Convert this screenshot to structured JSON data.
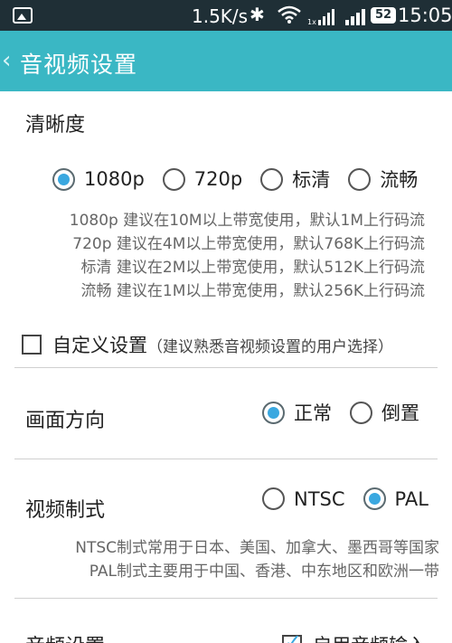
{
  "status_bar": {
    "speed": "1.5K/s",
    "battery": "52",
    "time": "15:05",
    "icons": [
      "image-icon",
      "bluetooth-icon",
      "wifi-icon",
      "signal-icon",
      "battery-icon"
    ]
  },
  "header": {
    "back_glyph": "《",
    "title": "音视频设置",
    "background": "#3ab7c4"
  },
  "resolution": {
    "title": "清晰度",
    "options": [
      {
        "label": "1080p",
        "selected": true
      },
      {
        "label": "720p",
        "selected": false
      },
      {
        "label": "标清",
        "selected": false
      },
      {
        "label": "流畅",
        "selected": false
      }
    ],
    "descriptions": [
      "1080p 建议在10M以上带宽使用，默认1M上行码流",
      "720p 建议在4M以上带宽使用，默认768K上行码流",
      "标清 建议在2M以上带宽使用，默认512K上行码流",
      "流畅 建议在1M以上带宽使用，默认256K上行码流"
    ]
  },
  "custom": {
    "label": "自定义设置",
    "hint": "（建议熟悉音视频设置的用户选择）",
    "checked": false
  },
  "orientation": {
    "title": "画面方向",
    "options": [
      {
        "label": "正常",
        "selected": true
      },
      {
        "label": "倒置",
        "selected": false
      }
    ]
  },
  "video_format": {
    "title": "视频制式",
    "options": [
      {
        "label": "NTSC",
        "selected": false
      },
      {
        "label": "PAL",
        "selected": true
      }
    ],
    "descriptions": [
      "NTSC制式常用于日本、美国、加拿大、墨西哥等国家",
      "PAL制式主要用于中国、香港、中东地区和欧洲一带"
    ]
  },
  "audio": {
    "title": "音频设置",
    "enable_label": "启用音频输入",
    "checked": true
  },
  "accent_color": "#3aa8e0"
}
